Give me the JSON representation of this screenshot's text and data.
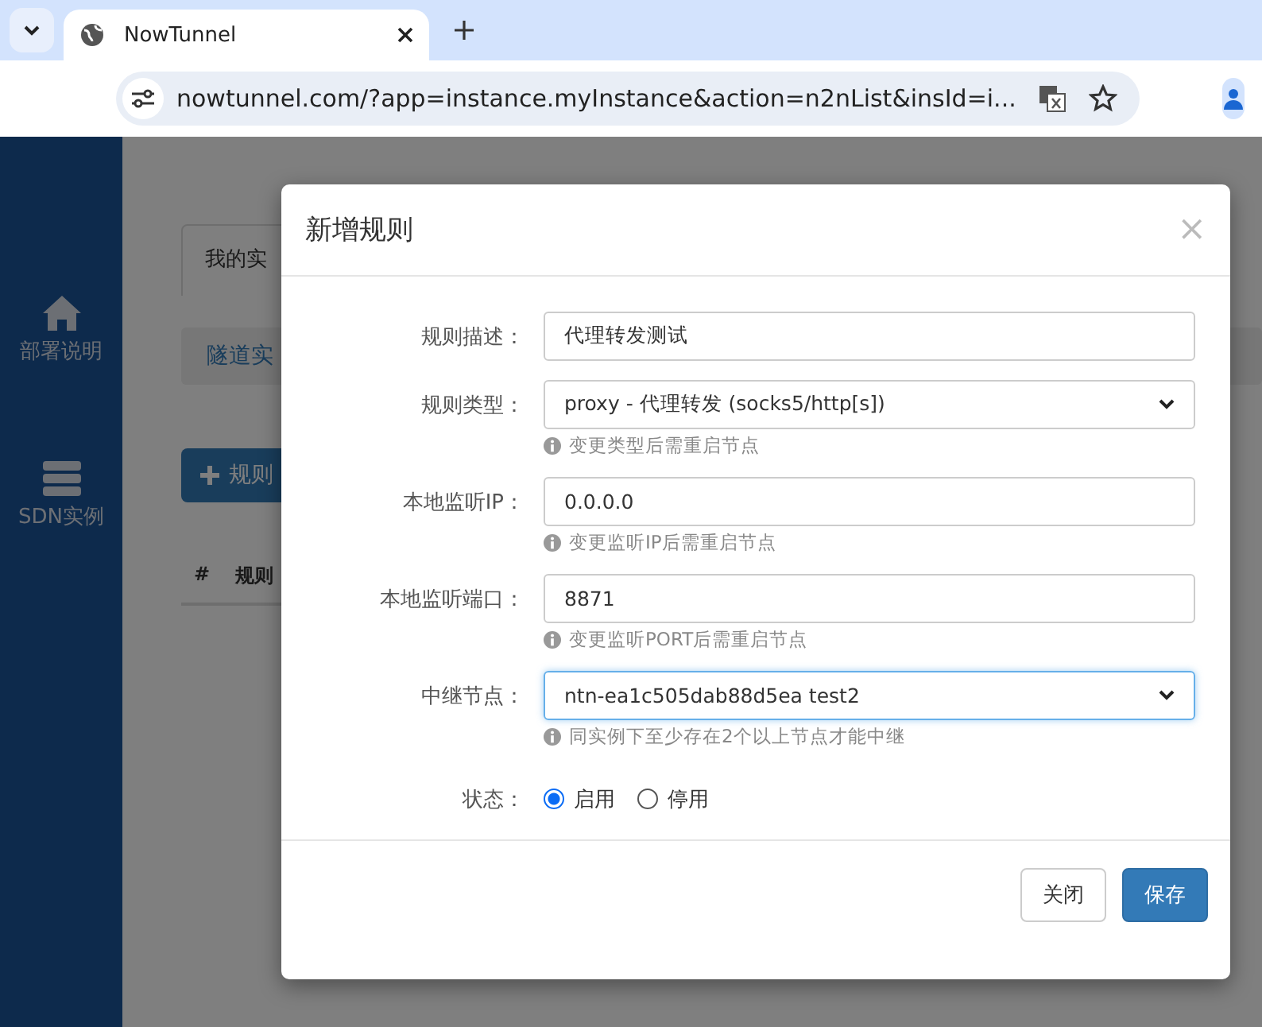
{
  "browser": {
    "tab_title": "NowTunnel",
    "url": "nowtunnel.com/?app=instance.myInstance&action=n2nList&insId=i..."
  },
  "sidebar": {
    "items": [
      {
        "kind": "home",
        "label": "部署说明"
      },
      {
        "kind": "server",
        "label": "SDN实例"
      }
    ]
  },
  "page": {
    "tab": "我的实",
    "subtab": "隧道实",
    "add_button": "规则",
    "table_columns": [
      "#",
      "规则"
    ]
  },
  "dialog": {
    "title": "新增规则",
    "close": "×",
    "fields": [
      {
        "kind": "text",
        "label": "规则描述：",
        "value": "代理转发测试",
        "focused": false
      },
      {
        "kind": "select",
        "label": "规则类型：",
        "value": "proxy - 代理转发 (socks5/http[s])",
        "hint": "变更类型后需重启节点",
        "focused": false
      },
      {
        "kind": "text",
        "label": "本地监听IP：",
        "value": "0.0.0.0",
        "hint": "变更监听IP后需重启节点",
        "focused": false
      },
      {
        "kind": "text",
        "label": "本地监听端口：",
        "value": "8871",
        "hint": "变更监听PORT后需重启节点",
        "focused": false
      },
      {
        "kind": "select",
        "label": "中继节点：",
        "value": "ntn-ea1c505dab88d5ea test2",
        "hint": "同实例下至少存在2个以上节点才能中继",
        "focused": true
      }
    ],
    "status": {
      "label": "状态：",
      "options": [
        {
          "label": "启用",
          "selected": true
        },
        {
          "label": "停用",
          "selected": false
        }
      ]
    },
    "buttons": [
      {
        "kind": "default",
        "label": "关闭"
      },
      {
        "kind": "primary",
        "label": "保存"
      }
    ]
  }
}
